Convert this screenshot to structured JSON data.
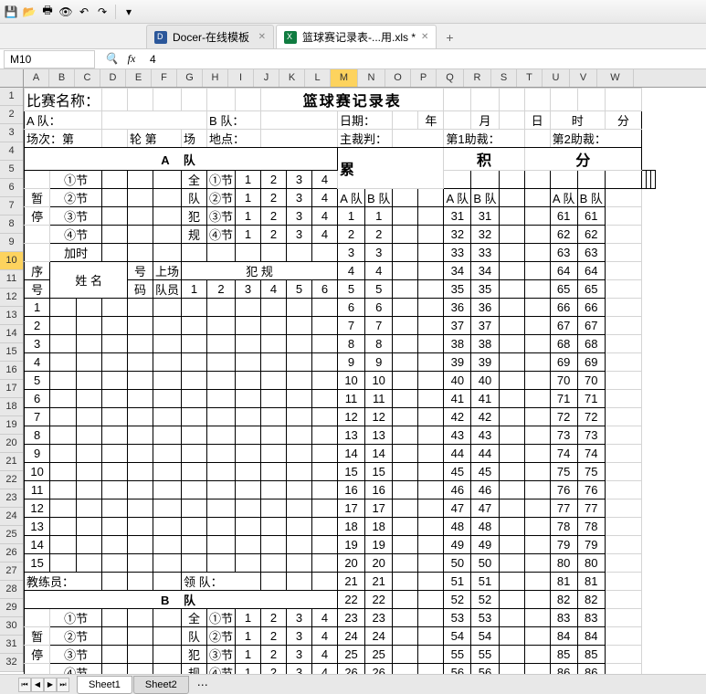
{
  "toolbar": {
    "save": "💾",
    "open": "📂",
    "print": "🖨",
    "preview": "🗎",
    "undo": "↶",
    "redo": "↷"
  },
  "tabs": {
    "docer": "Docer-在线模板",
    "file": "篮球赛记录表-...用.xls *"
  },
  "formula": {
    "name_box": "M10",
    "fx": "fx",
    "value": "4"
  },
  "cols": [
    "A",
    "B",
    "C",
    "D",
    "E",
    "F",
    "G",
    "H",
    "I",
    "J",
    "K",
    "L",
    "M",
    "N",
    "O",
    "P",
    "Q",
    "R",
    "S",
    "T",
    "U",
    "V",
    "W"
  ],
  "sheet": {
    "title_label": "比赛名称：",
    "title": "篮球赛记录表",
    "a_team": "A 队：",
    "b_team": "B 队：",
    "date": "日期：",
    "year": "年",
    "month": "月",
    "day": "日",
    "hour": "时",
    "minute": "分",
    "round_label": "场次：第",
    "round_unit": "轮 第",
    "game_unit": "场",
    "venue": "地点：",
    "chief_ref": "主裁判：",
    "ref1": "第1助裁：",
    "ref2": "第2助裁：",
    "team_a_header": "A   队",
    "team_b_header": "B   队",
    "quarters": [
      "①节",
      "②节",
      "③节",
      "④节"
    ],
    "overtime": "加时",
    "pause": "暂",
    "stop": "停",
    "full_team": "全队犯规",
    "full": "全",
    "team": "队",
    "foul": "犯",
    "rule": "规",
    "q_nums": [
      "1",
      "2",
      "3",
      "4"
    ],
    "seq": "序号",
    "seq1": "序",
    "seq2": "号",
    "name": "姓 名",
    "number": "号码",
    "num1": "号",
    "num2": "码",
    "onfield": "上场队员",
    "on1": "上场",
    "on2": "队员",
    "fouls_header": "犯  规",
    "foul_cols": [
      "1",
      "2",
      "3",
      "4",
      "5",
      "6"
    ],
    "score_header": "累　积　分",
    "score_h1": "累",
    "score_h2": "积",
    "score_h3": "分",
    "ab_header": [
      "A 队",
      "B 队",
      "A 队",
      "B 队",
      "A 队",
      "B 队"
    ],
    "coach": "教练员：",
    "leader": "领  队：",
    "player_nums": [
      "1",
      "2",
      "3",
      "4",
      "5",
      "6",
      "7",
      "8",
      "9",
      "10",
      "11",
      "12",
      "13",
      "14",
      "15"
    ],
    "score_col1": [
      1,
      2,
      3,
      4,
      5,
      6,
      7,
      8,
      9,
      10,
      11,
      12,
      13,
      14,
      15,
      16,
      17,
      18,
      19,
      20,
      21,
      22,
      23,
      24,
      25,
      26
    ],
    "score_col2": [
      31,
      32,
      33,
      34,
      35,
      36,
      37,
      38,
      39,
      40,
      41,
      42,
      43,
      44,
      45,
      46,
      47,
      48,
      49,
      50,
      51,
      52,
      53,
      54,
      55,
      56
    ],
    "score_col3": [
      61,
      62,
      63,
      64,
      65,
      66,
      67,
      68,
      69,
      70,
      71,
      72,
      73,
      74,
      75,
      76,
      77,
      78,
      79,
      80,
      81,
      82,
      83,
      84,
      85,
      86
    ]
  },
  "sheets": {
    "s1": "Sheet1",
    "s2": "Sheet2"
  }
}
